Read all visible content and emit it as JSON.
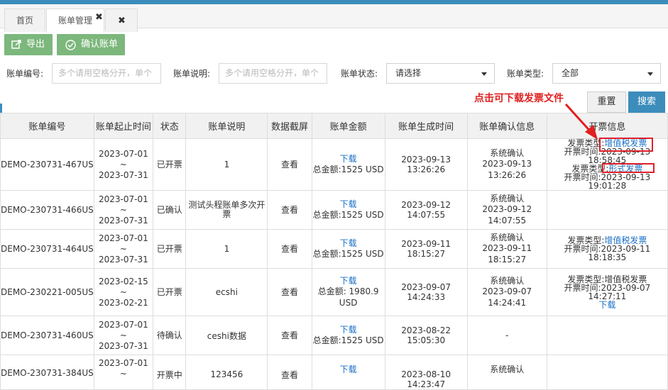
{
  "tabs": [
    {
      "label": "首页"
    },
    {
      "label": "账单管理"
    }
  ],
  "toolbar": {
    "export_label": "导出",
    "confirm_label": "确认账单"
  },
  "filters": {
    "bill_no_label": "账单编号:",
    "bill_no_placeholder": "多个请用空格分开，单个",
    "desc_label": "账单说明:",
    "desc_placeholder": "多个请用空格分开，单个",
    "status_label": "账单状态:",
    "status_value": "请选择",
    "type_label": "账单类型:",
    "type_value": "全部"
  },
  "annotation": "点击可下载发票文件",
  "actions": {
    "reset_label": "重置",
    "search_label": "搜索"
  },
  "table": {
    "headers": [
      "账单编号",
      "账单起止时间",
      "状态",
      "账单说明",
      "数据截屏",
      "账单金额",
      "账单生成时间",
      "账单确认信息",
      "开票信息"
    ],
    "rows": [
      {
        "bill_no": "DEMO-230731-467US",
        "start": "2023-07-01",
        "tilde": "~",
        "end": "2023-07-31",
        "status": "已开票",
        "desc": "1",
        "screenshot": "查看",
        "download": "下载",
        "amount": "总金额:1525 USD",
        "created": "2023-09-13 13:26:26",
        "confirm_by": "系统确认",
        "confirm_time": "2023-09-13 13:26:26",
        "invoice": [
          {
            "type_label": "发票类型:",
            "type": "增值税发票",
            "time_label": "开票时间:",
            "time": "2023-09-13 18:58:45"
          },
          {
            "type_label": "发票类型:",
            "type": "形式发票",
            "time_label": "开票时间:",
            "time": "2023-09-13 19:01:28"
          }
        ]
      },
      {
        "bill_no": "DEMO-230731-466US",
        "start": "2023-07-01",
        "tilde": "~",
        "end": "2023-07-31",
        "status": "已确认",
        "desc": "测试头程账单多次开票",
        "screenshot": "查看",
        "download": "下载",
        "amount": "总金额:1525 USD",
        "created": "2023-09-12 14:07:55",
        "confirm_by": "系统确认",
        "confirm_time": "2023-09-12 14:07:55"
      },
      {
        "bill_no": "DEMO-230731-464US",
        "start": "2023-07-01",
        "tilde": "~",
        "end": "2023-07-31",
        "status": "已开票",
        "desc": "1",
        "screenshot": "查看",
        "download": "下载",
        "amount": "总金额:1525 USD",
        "created": "2023-09-11 18:15:27",
        "confirm_by": "系统确认",
        "confirm_time": "2023-09-11 18:15:27",
        "invoice": [
          {
            "type_label": "发票类型:",
            "type": "增值税发票",
            "time_label": "开票时间:",
            "time": "2023-09-11 18:18:35"
          }
        ]
      },
      {
        "bill_no": "DEMO-230221-005US",
        "start": "2023-02-15",
        "tilde": "~",
        "end": "2023-02-21",
        "status": "已开票",
        "desc": "ecshi",
        "screenshot": "查看",
        "download": "下载",
        "amount": "总金额: 1980.9 USD",
        "created": "2023-09-07 14:24:33",
        "confirm_by": "系统确认",
        "confirm_time": "2023-09-07 14:24:41",
        "invoice_plain": {
          "type_line": "发票类型:增值税发票",
          "time_line": "开票时间:2023-09-07 14:27:11",
          "download": "下载"
        }
      },
      {
        "bill_no": "DEMO-230731-460US",
        "start": "2023-07-01",
        "tilde": "~",
        "end": "2023-07-31",
        "status": "待确认",
        "desc": "ceshi数据",
        "screenshot": "查看",
        "download": "下载",
        "amount": "总金额:1525 USD",
        "created": "2023-08-22 15:05:30",
        "confirm_dash": "-"
      },
      {
        "bill_no": "DEMO-230731-384US",
        "start": "2023-07-01",
        "tilde": "~",
        "end": "",
        "status": "开票中",
        "desc": "123456",
        "screenshot": "查看",
        "download": "下载",
        "amount": "",
        "created": "2023-08-10 14:23:47",
        "confirm_by": "系统确认",
        "confirm_time": ""
      }
    ]
  },
  "colors": {
    "accent": "#3c8dbc",
    "button_green": "#7cb77c",
    "link": "#1a6fc6",
    "annotation_red": "#e02020"
  }
}
